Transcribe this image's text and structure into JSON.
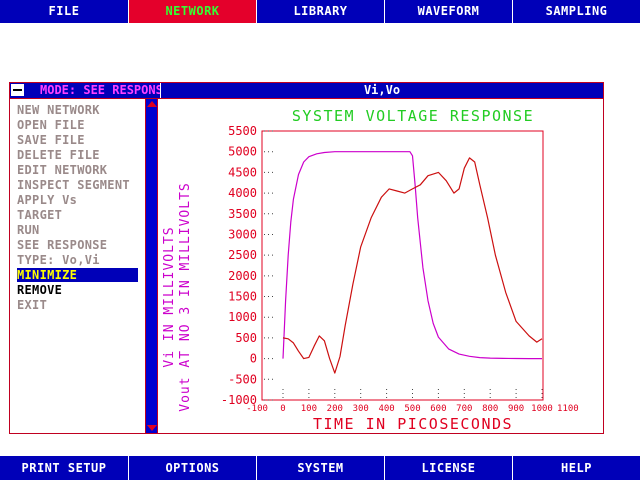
{
  "top_menu": {
    "items": [
      {
        "label": "FILE"
      },
      {
        "label": "NETWORK"
      },
      {
        "label": "LIBRARY"
      },
      {
        "label": "WAVEFORM"
      },
      {
        "label": "SAMPLING"
      }
    ],
    "active": "NETWORK"
  },
  "window": {
    "mode_label": "MODE: SEE RESPONSE",
    "title": "Vi,Vo"
  },
  "side_menu": {
    "items": [
      {
        "label": "NEW NETWORK"
      },
      {
        "label": "OPEN FILE"
      },
      {
        "label": "SAVE FILE"
      },
      {
        "label": "DELETE FILE"
      },
      {
        "label": "EDIT NETWORK"
      },
      {
        "label": "INSPECT SEGMENT"
      },
      {
        "label": "APPLY Vs"
      },
      {
        "label": "TARGET"
      },
      {
        "label": "RUN"
      },
      {
        "label": "SEE RESPONSE"
      },
      {
        "label": "TYPE: Vo,Vi"
      },
      {
        "label": "MINIMIZE"
      },
      {
        "label": "REMOVE"
      },
      {
        "label": "EXIT"
      }
    ],
    "selected": "MINIMIZE",
    "dark_items": [
      "REMOVE"
    ]
  },
  "bottom_menu": {
    "items": [
      {
        "label": "PRINT SETUP"
      },
      {
        "label": "OPTIONS"
      },
      {
        "label": "SYSTEM"
      },
      {
        "label": "LICENSE"
      },
      {
        "label": "HELP"
      }
    ]
  },
  "colors": {
    "menu_bar": "#0000b8",
    "active_tab": "#e4002b",
    "active_tab_text": "#33ff33",
    "title_green": "#22cc22",
    "axis_red": "#e00020",
    "vi_curve": "#cc00cc",
    "vo_curve": "#cc1010",
    "ylabel_magenta": "#cc00cc"
  },
  "chart_data": {
    "type": "line",
    "title": "SYSTEM VOLTAGE RESPONSE",
    "xlabel": "TIME IN PICOSECONDS",
    "ylabel_lines": [
      "Vi IN MILLIVOLTS",
      "Vout AT NO 3 IN MILLIVOLTS"
    ],
    "xlim": [
      -100,
      1100
    ],
    "ylim": [
      -1000,
      5500
    ],
    "x_ticks": [
      -100,
      0,
      100,
      200,
      300,
      400,
      500,
      600,
      700,
      800,
      900,
      1000,
      1100
    ],
    "x_tick_labels": [
      "-100",
      "0",
      "100",
      "200",
      "300",
      "400",
      "500",
      "600",
      "700",
      "800",
      "900",
      "1000",
      "1100"
    ],
    "y_ticks": [
      5500,
      5000,
      4500,
      4000,
      3500,
      3000,
      2500,
      2000,
      1500,
      1000,
      500,
      0,
      -500,
      -1000
    ],
    "y_tick_labels": [
      "5500",
      "5000",
      "4500",
      "4000",
      "3500",
      "3000",
      "2500",
      "2000",
      "1500",
      "1000",
      "500",
      "0",
      "-500",
      "-1000"
    ],
    "grid": false,
    "series": [
      {
        "name": "Vi",
        "color": "#cc00cc",
        "x": [
          0,
          10,
          20,
          30,
          40,
          60,
          80,
          100,
          130,
          160,
          200,
          250,
          300,
          350,
          400,
          490,
          500,
          510,
          520,
          540,
          560,
          580,
          600,
          640,
          680,
          720,
          760,
          800,
          850,
          900,
          950,
          1000
        ],
        "y": [
          0,
          1400,
          2500,
          3300,
          3850,
          4450,
          4750,
          4880,
          4950,
          4980,
          5000,
          5000,
          5000,
          5000,
          5000,
          5000,
          4900,
          4200,
          3400,
          2200,
          1400,
          850,
          520,
          230,
          110,
          55,
          25,
          12,
          5,
          2,
          1,
          0
        ]
      },
      {
        "name": "Vo",
        "color": "#cc1010",
        "x": [
          0,
          20,
          40,
          60,
          80,
          100,
          120,
          140,
          160,
          180,
          200,
          220,
          240,
          270,
          300,
          340,
          380,
          410,
          440,
          470,
          500,
          530,
          560,
          600,
          630,
          660,
          680,
          700,
          720,
          740,
          760,
          790,
          820,
          860,
          900,
          950,
          980,
          1000
        ],
        "y": [
          500,
          480,
          380,
          180,
          0,
          30,
          300,
          550,
          430,
          0,
          -350,
          50,
          800,
          1800,
          2700,
          3400,
          3900,
          4100,
          4050,
          4000,
          4100,
          4200,
          4420,
          4500,
          4300,
          4000,
          4100,
          4600,
          4850,
          4750,
          4200,
          3400,
          2500,
          1600,
          900,
          550,
          400,
          480
        ]
      }
    ]
  }
}
